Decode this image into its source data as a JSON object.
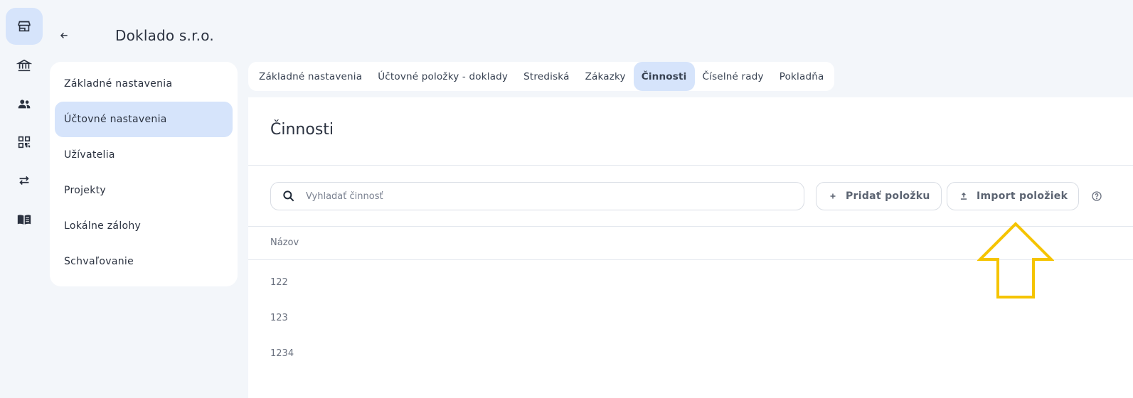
{
  "header": {
    "company_name": "Doklado s.r.o."
  },
  "rail": {
    "items": [
      {
        "icon": "store-icon",
        "active": true
      },
      {
        "icon": "bank-icon",
        "active": false
      },
      {
        "icon": "users-icon",
        "active": false
      },
      {
        "icon": "qr-code-icon",
        "active": false
      },
      {
        "icon": "transfer-icon",
        "active": false
      },
      {
        "icon": "book-icon",
        "active": false
      }
    ]
  },
  "settings_menu": {
    "items": [
      {
        "label": "Základné nastavenia"
      },
      {
        "label": "Účtovné nastavenia"
      },
      {
        "label": "Užívatelia"
      },
      {
        "label": "Projekty"
      },
      {
        "label": "Lokálne zálohy"
      },
      {
        "label": "Schvaľovanie"
      }
    ],
    "active_index": 1
  },
  "tabs": {
    "items": [
      {
        "label": "Základné nastavenia"
      },
      {
        "label": "Účtovné položky - doklady"
      },
      {
        "label": "Strediská"
      },
      {
        "label": "Zákazky"
      },
      {
        "label": "Činnosti"
      },
      {
        "label": "Číselné rady"
      },
      {
        "label": "Pokladňa"
      }
    ],
    "active_index": 4
  },
  "section": {
    "title": "Činnosti"
  },
  "search": {
    "placeholder": "Vyhladať činnosť",
    "value": ""
  },
  "toolbar": {
    "add_label": "Pridať položku",
    "import_label": "Import položiek"
  },
  "table": {
    "columns": [
      "Názov"
    ],
    "rows": [
      {
        "name": "122"
      },
      {
        "name": "123"
      },
      {
        "name": "1234"
      }
    ]
  },
  "colors": {
    "accent_bg": "#d6e4fb",
    "annotation_arrow": "#f5c400",
    "page_bg": "#f3f6fa"
  }
}
